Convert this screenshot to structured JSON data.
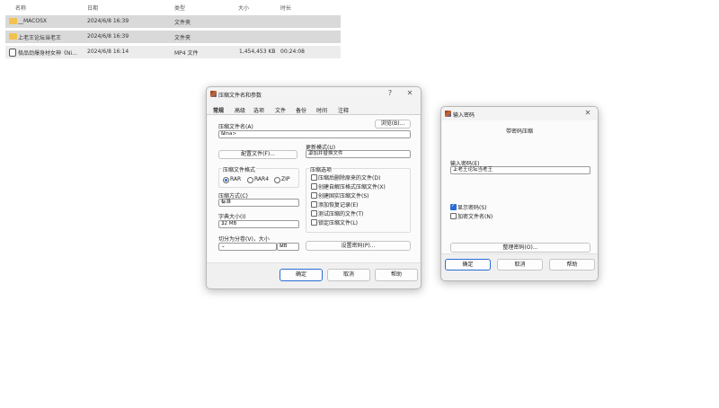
{
  "file_list": {
    "headers": [
      "名称",
      "日期",
      "类型",
      "大小",
      "时长"
    ],
    "rows": [
      {
        "name": "__MACOSX",
        "date": "2024/6/8 16:39",
        "type": "文件夹",
        "size": "",
        "duration": "",
        "icon": "folder-icon"
      },
      {
        "name": "上老王论坛当老王",
        "date": "2024/6/8 16:39",
        "type": "文件夹",
        "size": "",
        "duration": "",
        "icon": "folder-icon"
      },
      {
        "name": "极品劲爆身材女神《Ni...",
        "date": "2024/6/8 16:14",
        "type": "MP4 文件",
        "size": "1,454,453 KB",
        "duration": "00:24:08",
        "icon": "video-file-icon"
      }
    ]
  },
  "archive_dialog": {
    "title": "压缩文件名和参数",
    "help_btn": "?",
    "close_btn": "✕",
    "tabs": [
      "常规",
      "高级",
      "选项",
      "文件",
      "备份",
      "时间",
      "注释"
    ],
    "archive_name_label": "压缩文件名(A)",
    "browse_btn": "浏览(B)...",
    "archive_name_value": "Nina>",
    "profiles_btn": "配置文件(F)...",
    "update_mode_label": "更新模式(U)",
    "update_mode_value": "添加并替换文件",
    "format_group_label": "压缩文件格式",
    "formats": [
      "RAR",
      "RAR4",
      "ZIP"
    ],
    "format_selected": "RAR",
    "method_label": "压缩方式(C)",
    "method_value": "标准",
    "dict_label": "字典大小(I)",
    "dict_value": "32 MB",
    "split_label": "切分为分卷(V)，大小",
    "split_unit": "MB",
    "options_group_label": "压缩选项",
    "options": [
      {
        "label": "压缩后删除原来的文件(D)",
        "checked": false
      },
      {
        "label": "创建自解压格式压缩文件(X)",
        "checked": false
      },
      {
        "label": "创建固实压缩文件(S)",
        "checked": false
      },
      {
        "label": "添加恢复记录(E)",
        "checked": false
      },
      {
        "label": "测试压缩的文件(T)",
        "checked": false
      },
      {
        "label": "锁定压缩文件(L)",
        "checked": false
      }
    ],
    "set_password_btn": "设置密码(P)...",
    "ok_btn": "确定",
    "cancel_btn": "取消",
    "help_label": "帮助"
  },
  "password_dialog": {
    "title": "输入密码",
    "close_btn": "✕",
    "subtitle": "带密码压缩",
    "input_label": "输入密码(E)",
    "input_value": "上老王论坛当老王",
    "show_password": {
      "label": "显示密码(S)",
      "checked": true
    },
    "encrypt_names": {
      "label": "加密文件名(N)",
      "checked": false
    },
    "organize_btn": "整理密码(O)...",
    "ok_btn": "确定",
    "cancel_btn": "取消",
    "help_btn": "帮助"
  }
}
